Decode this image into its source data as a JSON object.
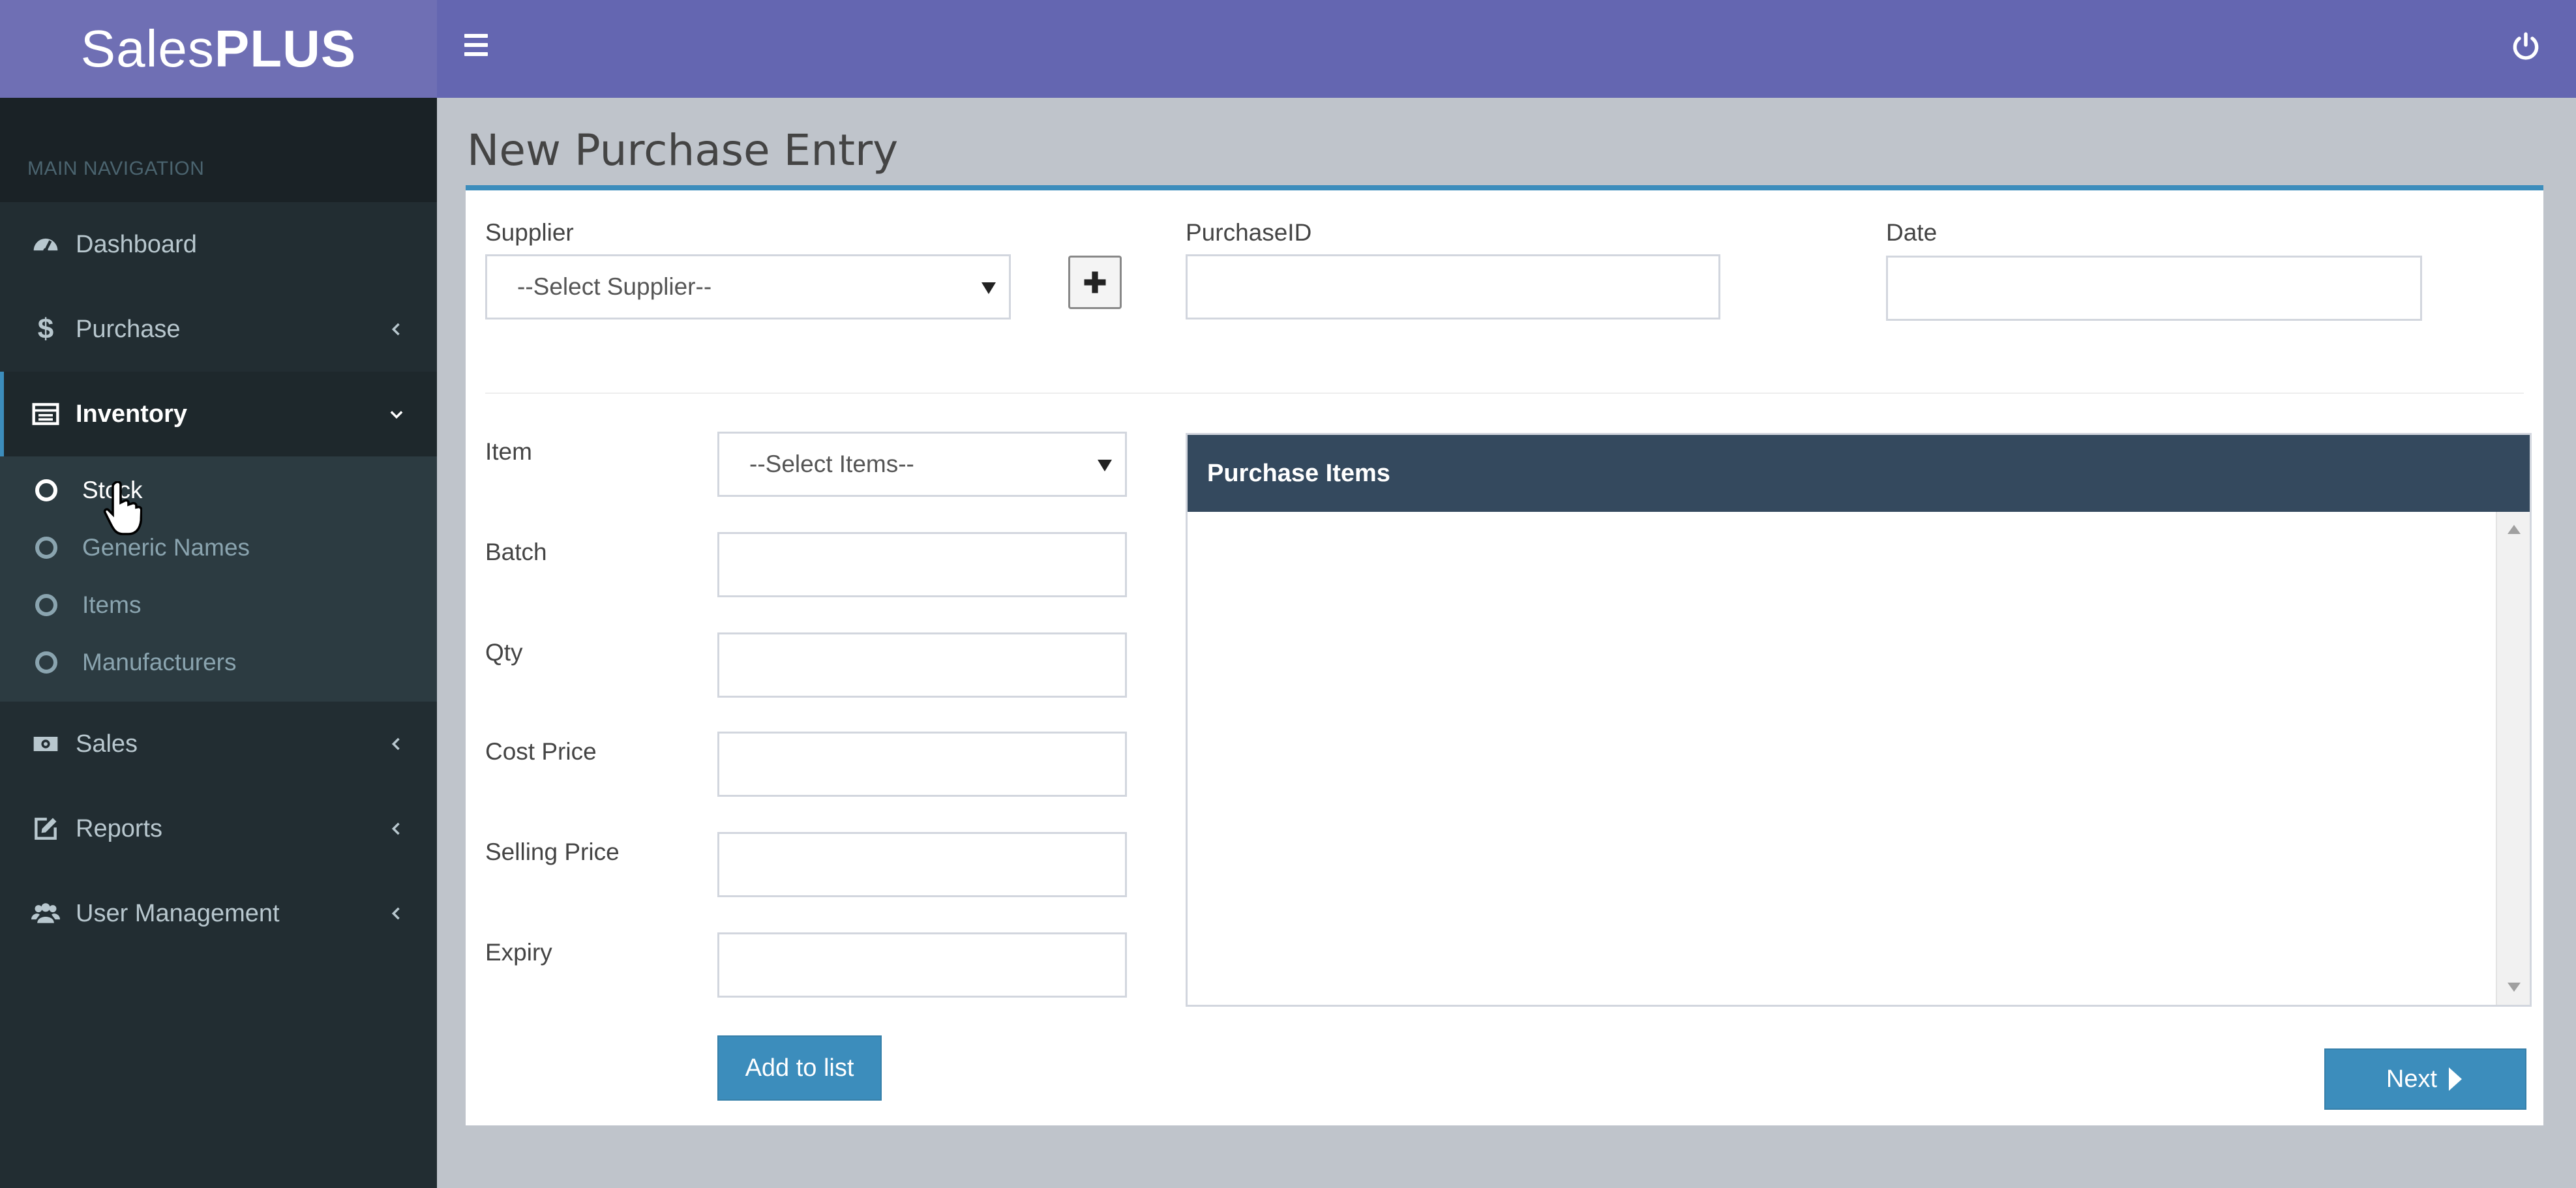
{
  "app": {
    "logo_regular": "Sales",
    "logo_bold": "PLUS"
  },
  "sidebar": {
    "header": "MAIN NAVIGATION",
    "items": [
      {
        "label": "Dashboard",
        "icon": "dashboard-icon"
      },
      {
        "label": "Purchase",
        "icon": "dollar-icon"
      },
      {
        "label": "Inventory",
        "icon": "inventory-icon"
      },
      {
        "label": "Sales",
        "icon": "money-icon"
      },
      {
        "label": "Reports",
        "icon": "edit-icon"
      },
      {
        "label": "User Management",
        "icon": "users-icon"
      }
    ],
    "inventory_sub": [
      "Stock",
      "Generic Names",
      "Items",
      "Manufacturers"
    ]
  },
  "page": {
    "title": "New Purchase Entry"
  },
  "form": {
    "supplier_label": "Supplier",
    "supplier_value": "--Select Supplier--",
    "purchase_id_label": "PurchaseID",
    "purchase_id_value": "",
    "date_label": "Date",
    "date_value": "",
    "item_label": "Item",
    "item_value": "--Select Items--",
    "batch_label": "Batch",
    "qty_label": "Qty",
    "cost_price_label": "Cost Price",
    "selling_price_label": "Selling Price",
    "expiry_label": "Expiry",
    "add_to_list_label": "Add to list"
  },
  "purchase_items": {
    "title": "Purchase Items"
  },
  "footer": {
    "next_label": "Next"
  },
  "colors": {
    "header": "#6466b1",
    "sidebar": "#222d32",
    "accent": "#3c8dbc",
    "panel_head": "#34495e"
  }
}
